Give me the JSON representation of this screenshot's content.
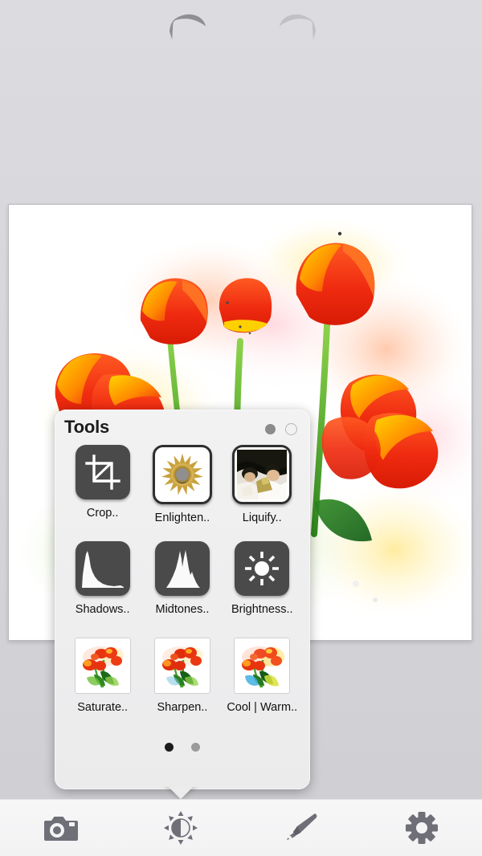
{
  "app": {
    "background_color": "#d7d7db",
    "canvas_background": "#ffffff"
  },
  "topbar": {
    "undo": {
      "label": "Undo",
      "icon": "undo-arrow-icon",
      "enabled": true,
      "color": "#8e8e93"
    },
    "redo": {
      "label": "Redo",
      "icon": "redo-arrow-icon",
      "enabled": false,
      "color": "#bdbdc2"
    }
  },
  "canvas": {
    "image_alt": "Watercolor painting of red and yellow tulips in a bouquet"
  },
  "popover": {
    "title": "Tools",
    "top_pager": [
      {
        "name": "page-dot-1",
        "state": "filled"
      },
      {
        "name": "page-dot-2",
        "state": "hollow"
      }
    ],
    "tools": [
      {
        "label": "Crop..",
        "icon": "crop-icon",
        "style": "dark"
      },
      {
        "label": "Enlighten..",
        "icon": "sunburst-icon",
        "style": "light"
      },
      {
        "label": "Liquify..",
        "icon": "liquify-photo-icon",
        "style": "photo"
      },
      {
        "label": "Shadows..",
        "icon": "histogram-shadows-icon",
        "style": "dark"
      },
      {
        "label": "Midtones..",
        "icon": "histogram-midtones-icon",
        "style": "dark"
      },
      {
        "label": "Brightness..",
        "icon": "sun-brightness-icon",
        "style": "dark"
      },
      {
        "label": "Saturate..",
        "icon": "saturate-thumb-icon",
        "style": "thumb"
      },
      {
        "label": "Sharpen..",
        "icon": "sharpen-thumb-icon",
        "style": "thumb"
      },
      {
        "label": "Cool | Warm..",
        "icon": "coolwarm-thumb-icon",
        "style": "thumb"
      }
    ],
    "bottom_pager": [
      {
        "name": "carousel-dot-1",
        "state": "active"
      },
      {
        "name": "carousel-dot-2",
        "state": "inactive"
      }
    ]
  },
  "bottombar": {
    "items": [
      {
        "label": "Camera",
        "icon": "camera-icon",
        "selected": false
      },
      {
        "label": "Tools",
        "icon": "brightness-contrast-icon",
        "selected": true
      },
      {
        "label": "Effects",
        "icon": "paintbrush-icon",
        "selected": false
      },
      {
        "label": "Settings",
        "icon": "gear-icon",
        "selected": false
      }
    ],
    "icon_color": "#6f6f78"
  }
}
